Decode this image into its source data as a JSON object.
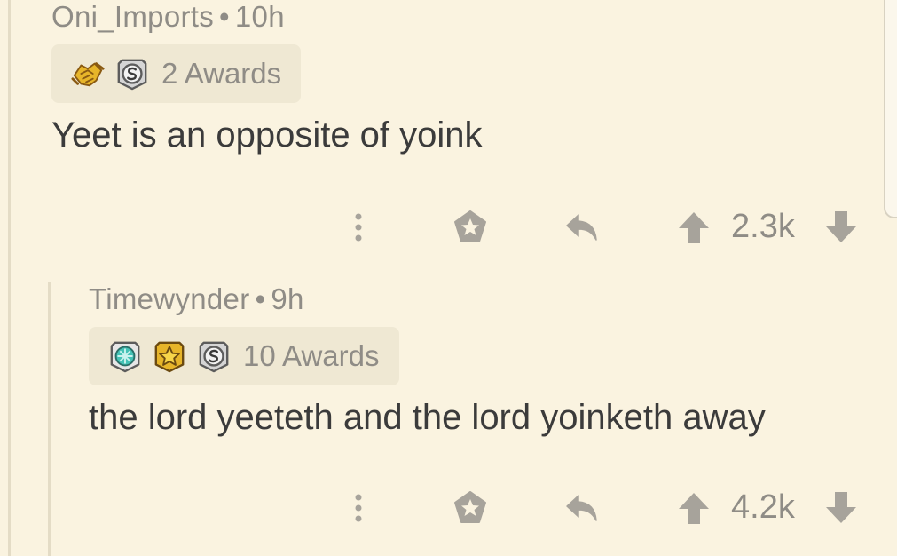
{
  "comments": [
    {
      "author": "Oni_Imports",
      "separator": "•",
      "age": "10h",
      "awards": {
        "icons": [
          "handshake-award-icon",
          "silver-award-icon"
        ],
        "label": "2 Awards"
      },
      "body": "Yeet is an opposite of yoink",
      "score": "2.3k"
    },
    {
      "author": "Timewynder",
      "separator": "•",
      "age": "9h",
      "awards": {
        "icons": [
          "platinum-award-icon",
          "gold-award-icon",
          "silver-award-icon"
        ],
        "label": "10 Awards"
      },
      "body": "the lord yeeteth and the lord yoinketh away",
      "score": "4.2k"
    }
  ],
  "colors": {
    "background": "#faf3e0",
    "muted_text": "#8f8c86",
    "body_text": "#3b3b3b",
    "icon_gray": "#a7a39b",
    "award_pill": "#efe8d3",
    "thread_line": "#e4dcc6",
    "gold": "#e7b52a",
    "silver": "#c9c9c9",
    "platinum": "#44c2b6"
  }
}
